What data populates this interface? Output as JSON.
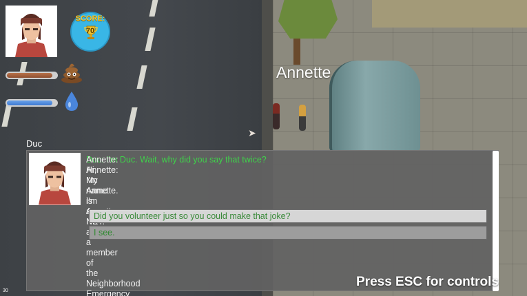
{
  "npc": {
    "name": "Annette"
  },
  "hud": {
    "score": {
      "label": "SCORE:",
      "value": "70",
      "badge_color": "#39b6e6"
    },
    "hunger": {
      "level": 0.92,
      "color": "#9a5a3a",
      "icon": "poop-icon"
    },
    "thirst": {
      "level": 0.92,
      "color": "#4a86dc",
      "icon": "water-drop-icon"
    }
  },
  "dialog": {
    "speaker": "Duc",
    "lines": [
      {
        "speaker_type": "npc",
        "text": "Annette: Hi, I'm Annette. I'm a NET."
      },
      {
        "speaker_type": "player",
        "text": "Duc: I'm Duc. Wait, why did you say that twice?"
      },
      {
        "speaker_type": "npc",
        "text": "Annette: My name is Annette. I'm also a member of the Neighborhood Emergency Teams, so I'm a NET. We're citizens trained for, well, this."
      }
    ],
    "options": [
      {
        "text": "Did you volunteer just so you could make that joke?",
        "selected": true
      },
      {
        "text": "I see.",
        "selected": false
      }
    ],
    "player_color": "#3fd24a"
  },
  "footer": {
    "hint": "Press ESC for controls",
    "fps": "30"
  }
}
